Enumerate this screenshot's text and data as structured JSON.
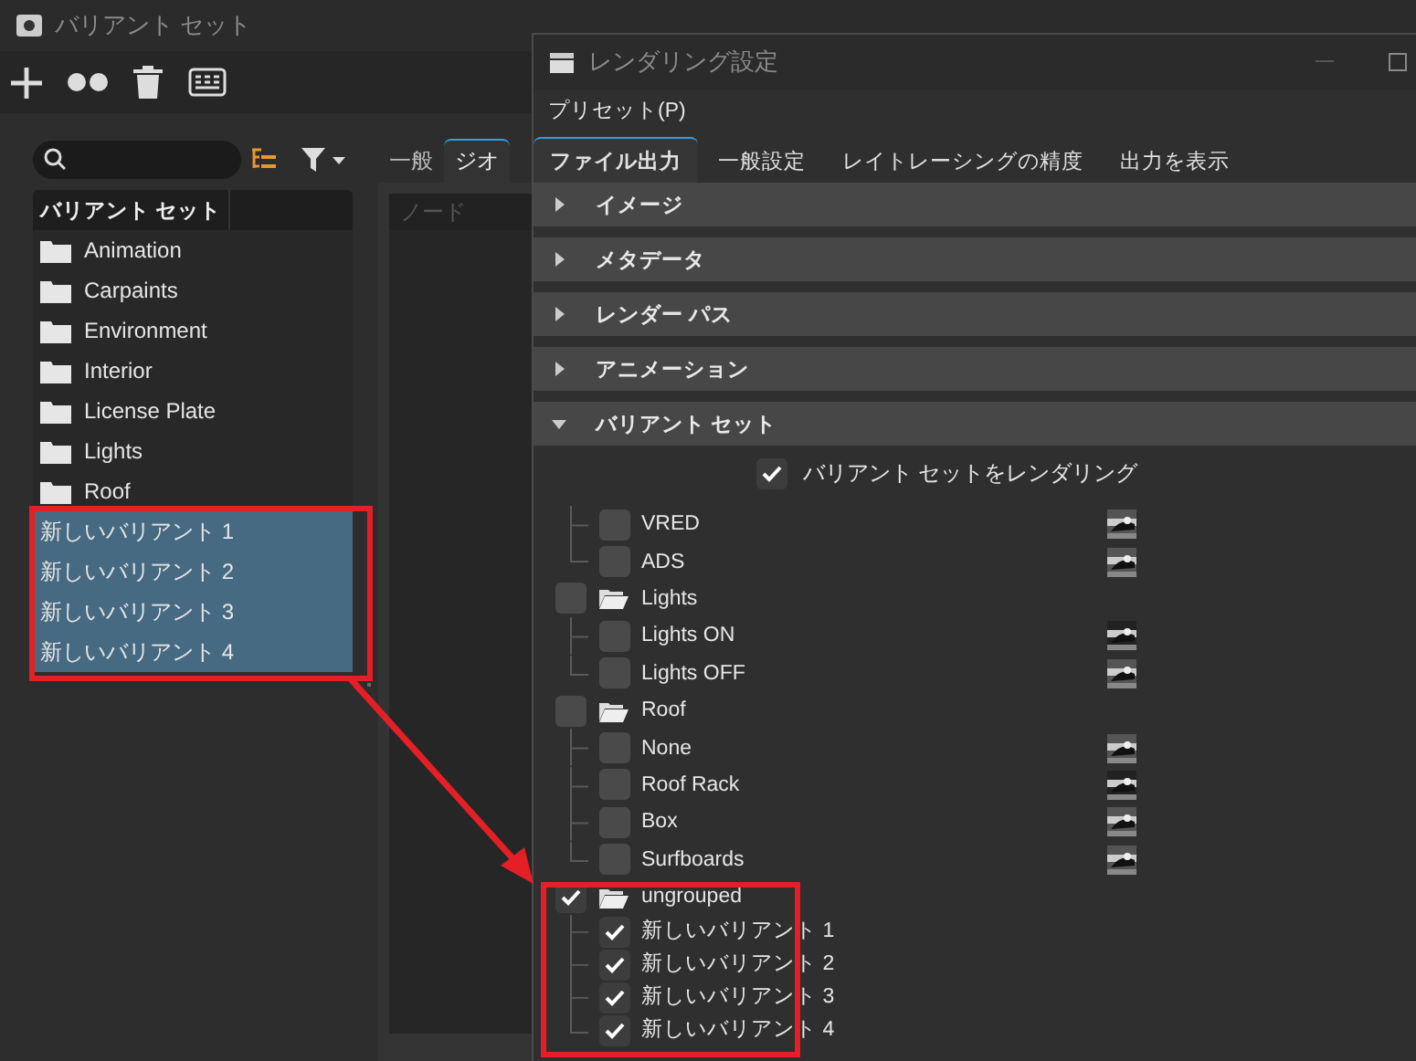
{
  "main_window": {
    "title": "バリアント セット"
  },
  "variant_sets": {
    "column": "バリアント セット",
    "items": [
      {
        "name": "Animation",
        "kind": "folder",
        "selected": false
      },
      {
        "name": "Carpaints",
        "kind": "folder",
        "selected": false
      },
      {
        "name": "Environment",
        "kind": "folder",
        "selected": false
      },
      {
        "name": "Interior",
        "kind": "folder",
        "selected": false
      },
      {
        "name": "License Plate",
        "kind": "folder",
        "selected": false
      },
      {
        "name": "Lights",
        "kind": "folder",
        "selected": false
      },
      {
        "name": "Roof",
        "kind": "folder",
        "selected": false
      },
      {
        "name": "新しいバリアント 1",
        "kind": "variant",
        "selected": true
      },
      {
        "name": "新しいバリアント 2",
        "kind": "variant",
        "selected": true
      },
      {
        "name": "新しいバリアント 3",
        "kind": "variant",
        "selected": true
      },
      {
        "name": "新しいバリアント 4",
        "kind": "variant",
        "selected": true
      }
    ]
  },
  "editor_tabs": [
    {
      "label": "一般",
      "selected": false
    },
    {
      "label": "ジオ",
      "selected": true
    }
  ],
  "node_column": "ノード",
  "dialog": {
    "title": "レンダリング設定",
    "menu": [
      "プリセット(P)"
    ],
    "tabs": [
      {
        "label": "ファイル出力",
        "selected": true
      },
      {
        "label": "一般設定",
        "selected": false
      },
      {
        "label": "レイトレーシングの精度",
        "selected": false
      },
      {
        "label": "出力を表示",
        "selected": false
      }
    ],
    "sections": [
      {
        "title": "イメージ",
        "expanded": false
      },
      {
        "title": "メタデータ",
        "expanded": false
      },
      {
        "title": "レンダー パス",
        "expanded": false
      },
      {
        "title": "アニメーション",
        "expanded": false
      },
      {
        "title": "バリアント セット",
        "expanded": true
      }
    ],
    "render_variant_sets": {
      "label": "バリアント セットをレンダリング",
      "checked": true
    },
    "variant_tree": [
      {
        "kind": "continued",
        "children": [
          {
            "name": "VRED",
            "checked": false
          },
          {
            "name": "ADS",
            "checked": false
          }
        ]
      },
      {
        "kind": "group",
        "name": "Lights",
        "checked": false,
        "children": [
          {
            "name": "Lights ON",
            "checked": false
          },
          {
            "name": "Lights OFF",
            "checked": false
          }
        ]
      },
      {
        "kind": "group",
        "name": "Roof",
        "checked": false,
        "children": [
          {
            "name": "None",
            "checked": false
          },
          {
            "name": "Roof Rack",
            "checked": false
          },
          {
            "name": "Box",
            "checked": false
          },
          {
            "name": "Surfboards",
            "checked": false
          }
        ]
      },
      {
        "kind": "group",
        "name": "ungrouped",
        "checked": true,
        "children": [
          {
            "name": "新しいバリアント 1",
            "checked": true,
            "kind": "plain"
          },
          {
            "name": "新しいバリアント 2",
            "checked": true,
            "kind": "plain"
          },
          {
            "name": "新しいバリアント 3",
            "checked": true,
            "kind": "plain"
          },
          {
            "name": "新しいバリアント 4",
            "checked": true,
            "kind": "plain"
          }
        ]
      }
    ]
  }
}
